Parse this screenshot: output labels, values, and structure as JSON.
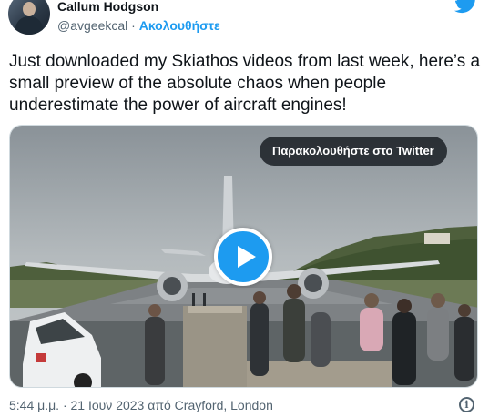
{
  "author": {
    "name": "Callum Hodgson",
    "handle": "@avgeekcal",
    "separator": " · ",
    "follow_label": "Ακολουθήστε"
  },
  "tweet": {
    "text": "Just downloaded my Skiathos videos from last week, here’s a small preview of the absolute chaos when people underestimate the power of aircraft engines!"
  },
  "media": {
    "watch_label": "Παρακολουθήστε στο Twitter",
    "play_icon": "play-icon"
  },
  "meta": {
    "time": "5:44 μ.μ.",
    "sep1": " · ",
    "date": "21 Ιουν 2023",
    "from_prefix": " από ",
    "location": "Crayford, London"
  },
  "icons": {
    "logo": "twitter-bird-icon",
    "info": "info-icon",
    "info_glyph": "i"
  },
  "colors": {
    "accent": "#1d9bf0",
    "text": "#0f1419",
    "muted": "#536471"
  }
}
